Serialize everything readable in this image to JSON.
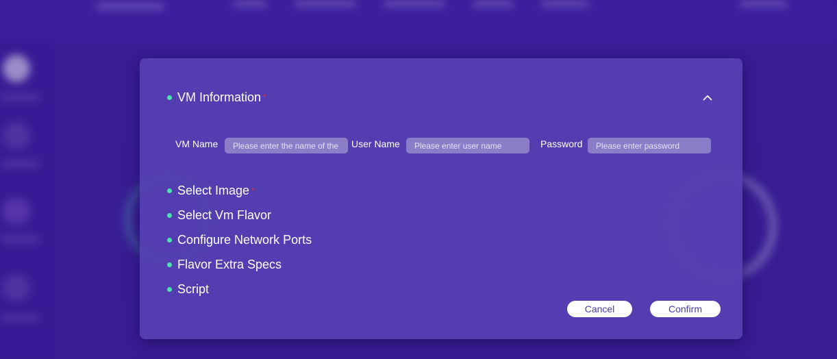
{
  "modal": {
    "sections": {
      "vm_information": {
        "label": "VM Information",
        "required_mark": "*"
      },
      "select_image": {
        "label": "Select Image",
        "required_mark": "*"
      },
      "select_vm_flavor": {
        "label": "Select Vm Flavor"
      },
      "configure_network_ports": {
        "label": "Configure Network Ports"
      },
      "flavor_extra_specs": {
        "label": "Flavor Extra Specs"
      },
      "script": {
        "label": "Script"
      }
    },
    "fields": {
      "vm_name": {
        "label": "VM Name",
        "placeholder": "Please enter the name of the",
        "value": ""
      },
      "user_name": {
        "label": "User Name",
        "placeholder": "Please enter user name",
        "value": ""
      },
      "password": {
        "label": "Password",
        "placeholder": "Please enter password",
        "value": ""
      }
    },
    "buttons": {
      "cancel": "Cancel",
      "confirm": "Confirm"
    },
    "icons": {
      "collapse": "chevron-up-icon",
      "bullet": "dot-icon"
    },
    "colors": {
      "bullet": "#4ee0b0",
      "required": "#e0304a",
      "input_bg": "#8c7dc9",
      "button_text": "#4a3aa6"
    }
  }
}
